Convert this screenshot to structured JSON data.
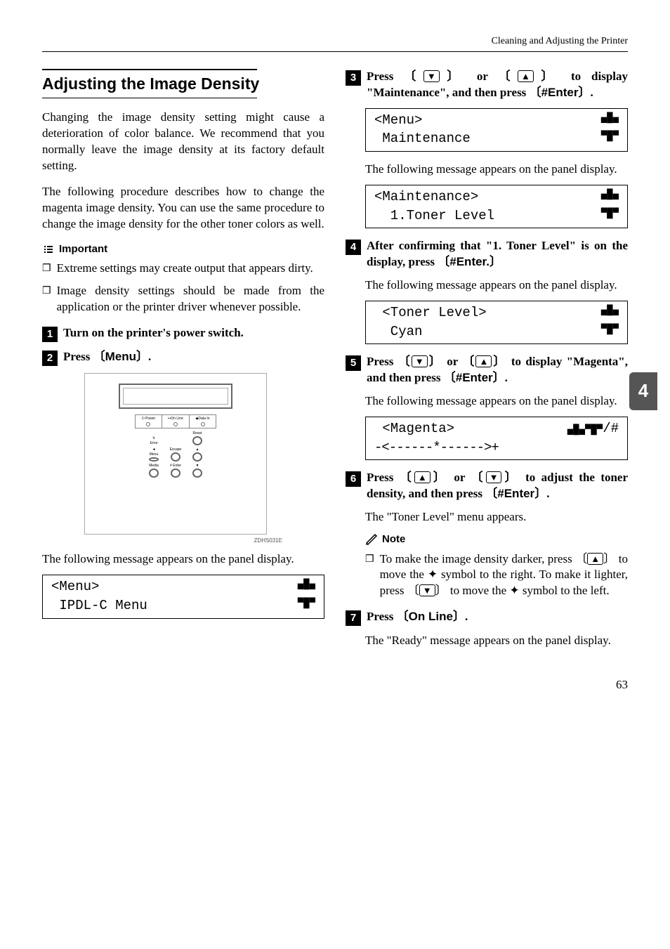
{
  "header": "Cleaning and Adjusting the Printer",
  "section_title": "Adjusting the Image Density",
  "intro1": "Changing the image density setting might cause a deterioration of color balance. We recommend that you normally leave the image density at its factory default setting.",
  "intro2": "The following procedure describes how to change the magenta image density. You can use the same procedure to change the image density for the other toner colors as well.",
  "important_label": "Important",
  "important_items": [
    "Extreme settings may create output that appears dirty.",
    "Image density settings should be made from the application or the printer driver whenever possible."
  ],
  "steps": {
    "1": {
      "pre": "Turn on the printer's power switch."
    },
    "2": {
      "pre": "Press ",
      "key": "Menu",
      "post": "."
    },
    "3": {
      "pre": "Press ",
      "mid": " or ",
      "post2": " to display \"Maintenance\", and then press ",
      "key": "#Enter",
      "post": "."
    },
    "4": {
      "pre": "After confirming that \"1. Toner Level\" is on the display, press ",
      "key": "#Enter.",
      "post": ""
    },
    "5": {
      "pre": "Press ",
      "mid": " or ",
      "post2": " to display \"Magenta\", and then press ",
      "key": "#Enter",
      "post": "."
    },
    "6": {
      "pre": "Press ",
      "mid": " or ",
      "post2": " to adjust the toner density, and then press ",
      "key": "#Enter",
      "post": "."
    },
    "7": {
      "pre": "Press ",
      "key": "On Line",
      "post": "."
    }
  },
  "msg_appears": "The following message appears on the panel display.",
  "toner_menu_appears": "The \"Toner Level\" menu appears.",
  "ready_appears": "The \"Ready\" message appears on the panel display.",
  "panels": {
    "menu_ipdl": {
      "l1l": "<Menu>",
      "l2l": " IPDL-C Menu"
    },
    "menu_maint": {
      "l1l": "<Menu>",
      "l2l": " Maintenance"
    },
    "maint_toner": {
      "l1l": "<Maintenance>",
      "l2l": "  1.Toner Level"
    },
    "toner_cyan": {
      "l1l": " <Toner Level>",
      "l2l": "  Cyan"
    },
    "magenta": {
      "l1l": " <Magenta>",
      "l1r": "jl/#",
      "l2l": "   ",
      "l2c": "-<------*------>+"
    }
  },
  "hw": {
    "caption": "ZDHS031E",
    "lamps": [
      "Power",
      "On Line",
      "Data In"
    ],
    "lbl_reset": "Reset",
    "lbl_error": "Error",
    "lbl_menu": "Menu",
    "lbl_escape": "Escape",
    "lbl_media": "Media",
    "lbl_enter": "# Enter"
  },
  "note_label": "Note",
  "note_body_a": "To make the image density darker, press ",
  "note_body_b": " to move the ",
  "note_body_c": " symbol to the right. To make it lighter, press ",
  "note_body_d": " to move the ",
  "note_body_e": " symbol to the left.",
  "side_tab": "4",
  "page_num": "63"
}
